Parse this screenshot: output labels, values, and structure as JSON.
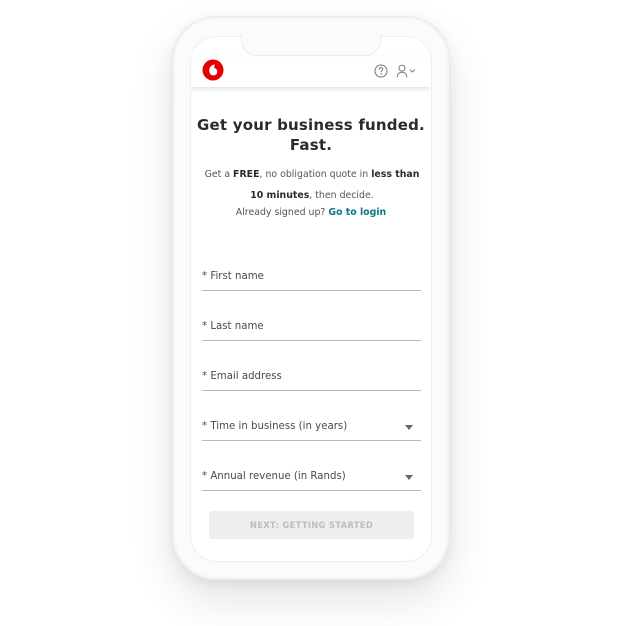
{
  "brand": {
    "logo_icon": "vodafone-speech-mark-icon",
    "accent_color": "#e60000",
    "link_color": "#0f7687"
  },
  "header": {
    "help_icon": "question-circle-icon",
    "user_icon": "user-chevron-down-icon"
  },
  "hero": {
    "title_line1": "Get your business funded.",
    "title_line2": "Fast."
  },
  "description": {
    "part1": "Get a ",
    "free": "FREE",
    "part2": ", no obligation quote in ",
    "less_than": "less than",
    "ten_minutes": "10 minutes",
    "part3": ", then decide."
  },
  "login": {
    "prompt": "Already signed up? ",
    "link_label": "Go to login"
  },
  "form": {
    "first_name": "* First name",
    "last_name": "* Last name",
    "email": "* Email address",
    "time_in_business": "* Time in business (in years)",
    "annual_revenue": "* Annual revenue (in Rands)"
  },
  "next_button": {
    "label": "NEXT: GETTING STARTED"
  }
}
